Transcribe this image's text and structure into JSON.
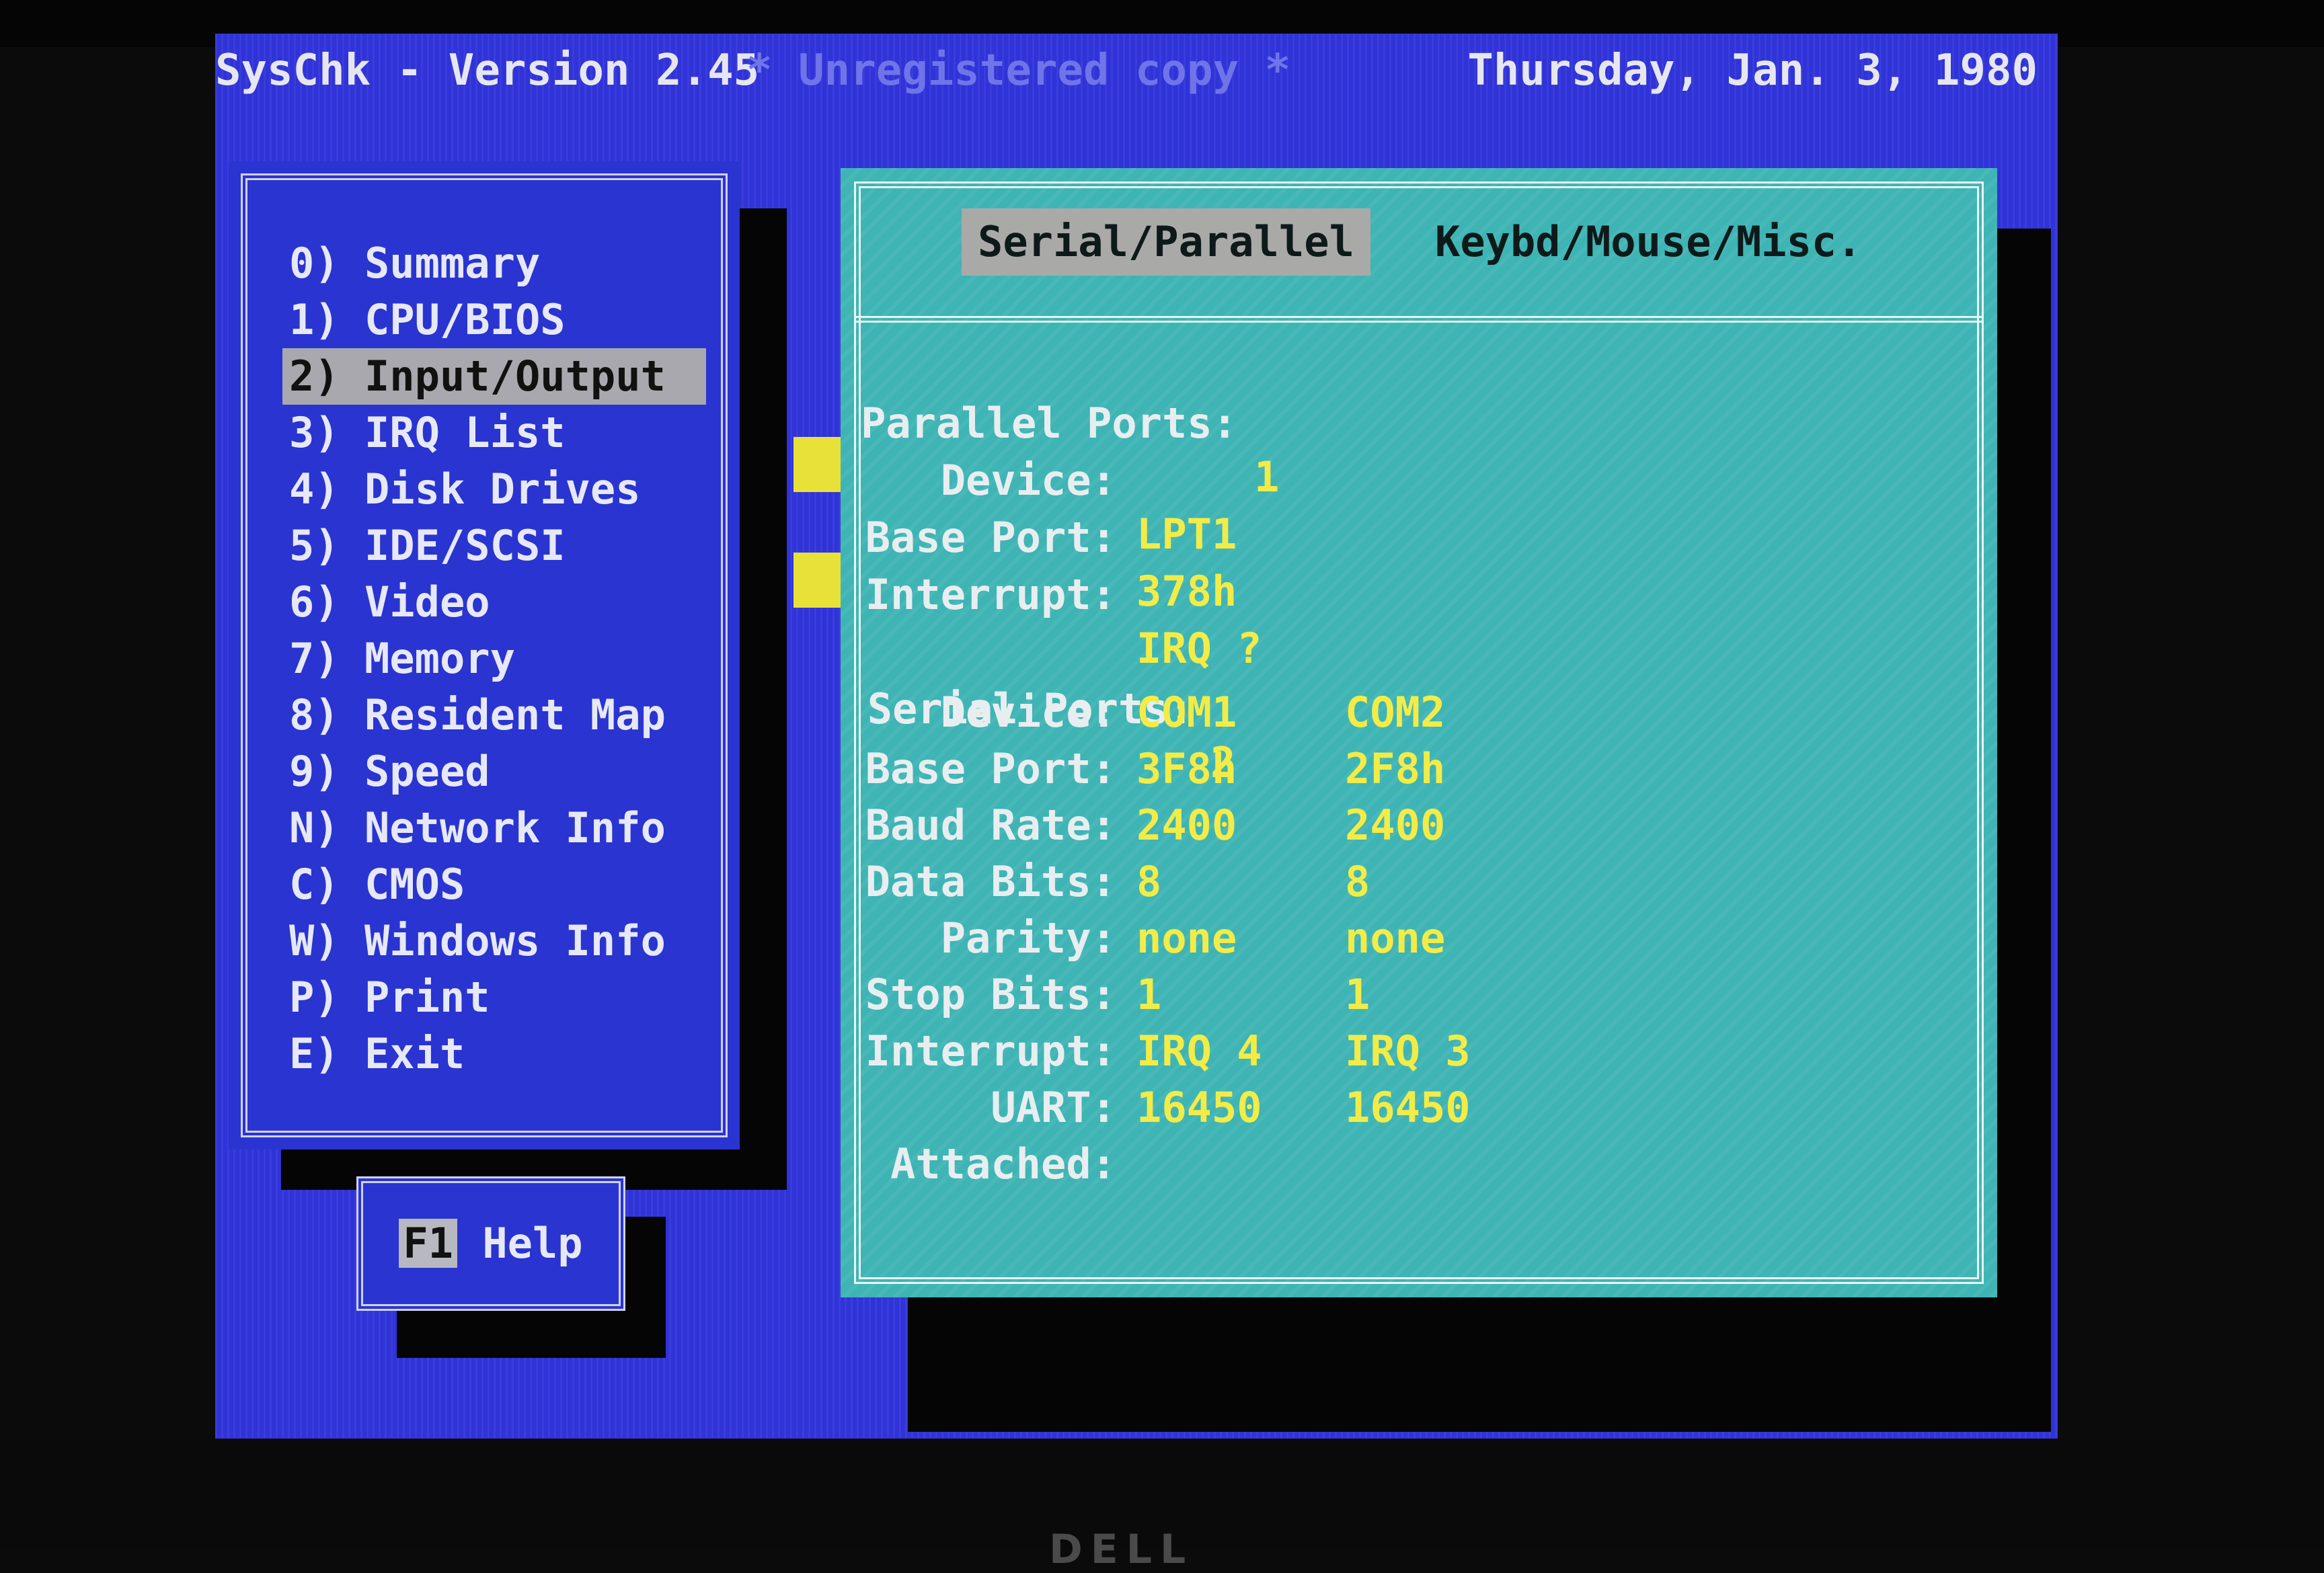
{
  "title_bar": {
    "app": "SysChk - Version 2.45",
    "unregistered": "* Unregistered copy *",
    "date": "Thursday, Jan. 3, 1980"
  },
  "menu": {
    "items": [
      {
        "key": "0)",
        "label": "Summary"
      },
      {
        "key": "1)",
        "label": "CPU/BIOS"
      },
      {
        "key": "2)",
        "label": "Input/Output",
        "active": true
      },
      {
        "key": "3)",
        "label": "IRQ List"
      },
      {
        "key": "4)",
        "label": "Disk Drives"
      },
      {
        "key": "5)",
        "label": "IDE/SCSI"
      },
      {
        "key": "6)",
        "label": "Video"
      },
      {
        "key": "7)",
        "label": "Memory"
      },
      {
        "key": "8)",
        "label": "Resident Map"
      },
      {
        "key": "9)",
        "label": "Speed"
      },
      {
        "key": "N)",
        "label": "Network Info"
      },
      {
        "key": "C)",
        "label": "CMOS"
      },
      {
        "key": "W)",
        "label": "Windows Info"
      },
      {
        "key": "P)",
        "label": "Print"
      },
      {
        "key": "E)",
        "label": "Exit"
      }
    ]
  },
  "help": {
    "key": "F1",
    "label": "Help"
  },
  "tabs": {
    "active": "Serial/Parallel",
    "inactive": "Keybd/Mouse/Misc."
  },
  "parallel": {
    "ports_label": "Parallel Ports:",
    "ports_value": "1",
    "device_label": "Device:",
    "device_value": "LPT1",
    "base_label": "Base Port:",
    "base_value": "378h",
    "irq_label": "Interrupt:",
    "irq_value": "IRQ ?"
  },
  "serial": {
    "ports_label": "Serial Ports:",
    "ports_value": "2",
    "rows": [
      {
        "label": "Device:",
        "com1": "COM1",
        "com2": "COM2"
      },
      {
        "label": "Base Port:",
        "com1": "3F8h",
        "com2": "2F8h"
      },
      {
        "label": "Baud Rate:",
        "com1": "2400",
        "com2": "2400"
      },
      {
        "label": "Data Bits:",
        "com1": "8",
        "com2": "8"
      },
      {
        "label": "Parity:",
        "com1": "none",
        "com2": "none"
      },
      {
        "label": "Stop Bits:",
        "com1": "1",
        "com2": "1"
      },
      {
        "label": "Interrupt:",
        "com1": "IRQ 4",
        "com2": "IRQ 3"
      },
      {
        "label": "UART:",
        "com1": "16450",
        "com2": "16450"
      },
      {
        "label": "Attached:",
        "com1": "",
        "com2": ""
      }
    ]
  },
  "bezel_logo": "DELL",
  "colors": {
    "screen_blue": "#2f33d8",
    "panel_cyan": "#3fb4b4",
    "value_yellow": "#f2ec48",
    "highlight_gray": "#a8a8ae"
  }
}
